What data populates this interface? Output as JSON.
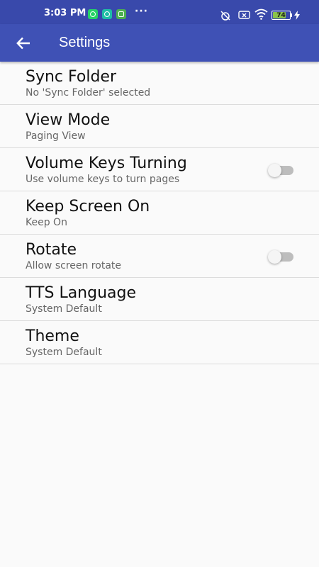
{
  "status_bar": {
    "time": "3:03 PM",
    "more": "···",
    "battery_level": "74",
    "notification_icons": [
      "whatsapp-icon",
      "whatsapp-business-icon",
      "app-icon"
    ],
    "system_icons": [
      "alarm-off-icon",
      "no-sim-icon",
      "wifi-icon",
      "battery-icon",
      "charging-icon"
    ]
  },
  "toolbar": {
    "title": "Settings",
    "back_icon": "arrow-back-icon"
  },
  "settings": [
    {
      "title": "Sync Folder",
      "subtitle": "No 'Sync Folder' selected",
      "switch": false
    },
    {
      "title": "View Mode",
      "subtitle": "Paging View",
      "switch": false
    },
    {
      "title": "Volume Keys Turning",
      "subtitle": "Use volume keys to turn pages",
      "switch": true,
      "switch_on": false
    },
    {
      "title": "Keep Screen On",
      "subtitle": "Keep On",
      "switch": false
    },
    {
      "title": "Rotate",
      "subtitle": "Allow screen rotate",
      "switch": true,
      "switch_on": false
    },
    {
      "title": "TTS Language",
      "subtitle": "System Default",
      "switch": false
    },
    {
      "title": "Theme",
      "subtitle": "System Default",
      "switch": false
    }
  ],
  "colors": {
    "status_bar": "#3949ab",
    "toolbar": "#3f51b5",
    "background": "#fafafa",
    "battery": "#8bc34a"
  }
}
